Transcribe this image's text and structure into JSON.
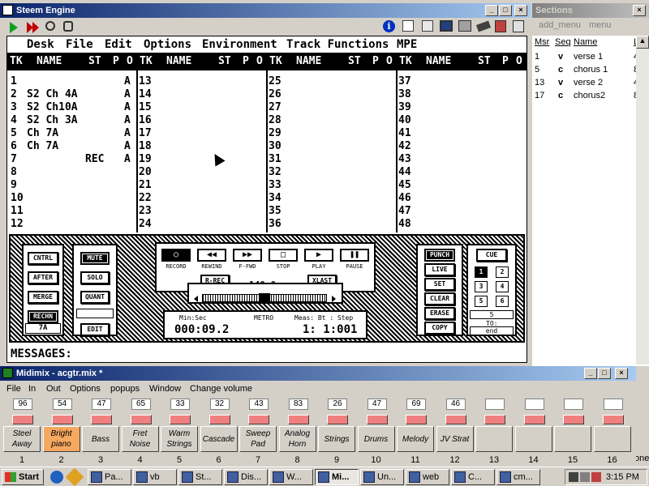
{
  "steem": {
    "title": "Steem Engine",
    "menus": [
      "Desk",
      "File",
      "Edit",
      "Options",
      "Environment",
      "Track Functions",
      "MPE"
    ],
    "headers": {
      "tk": "TK",
      "name": "NAME",
      "st": "ST",
      "p": "P",
      "o": "O"
    },
    "tracks": [
      {
        "n": "1",
        "name": "",
        "st": "",
        "a": "A"
      },
      {
        "n": "2",
        "name": "S2 Ch 4A",
        "st": "",
        "a": "A"
      },
      {
        "n": "3",
        "name": "S2 Ch10A",
        "st": "",
        "a": "A"
      },
      {
        "n": "4",
        "name": "S2 Ch 3A",
        "st": "",
        "a": "A"
      },
      {
        "n": "5",
        "name": "Ch 7A",
        "st": "",
        "a": "A"
      },
      {
        "n": "6",
        "name": "Ch 7A",
        "st": "",
        "a": "A"
      },
      {
        "n": "7",
        "name": "",
        "st": "REC",
        "a": "A"
      },
      {
        "n": "8",
        "name": "",
        "st": "",
        "a": ""
      },
      {
        "n": "9",
        "name": "",
        "st": "",
        "a": ""
      },
      {
        "n": "10",
        "name": "",
        "st": "",
        "a": ""
      },
      {
        "n": "11",
        "name": "",
        "st": "",
        "a": ""
      },
      {
        "n": "12",
        "name": "",
        "st": "",
        "a": ""
      }
    ],
    "col2": [
      "13",
      "14",
      "15",
      "16",
      "17",
      "18",
      "19",
      "20",
      "21",
      "22",
      "23",
      "24"
    ],
    "col3": [
      "25",
      "26",
      "27",
      "28",
      "29",
      "30",
      "31",
      "32",
      "33",
      "34",
      "35",
      "36"
    ],
    "col4": [
      "37",
      "38",
      "39",
      "40",
      "41",
      "42",
      "43",
      "44",
      "45",
      "46",
      "47",
      "48"
    ],
    "left_buttons": [
      "CNTRL",
      "AFTER",
      "MERGE",
      "RECHN"
    ],
    "mid_buttons": [
      "MUTE",
      "SOLO",
      "QUANT",
      "EDIT"
    ],
    "channel_value": "7A",
    "transport": [
      "RECORD",
      "REWIND",
      "F-FWD",
      "STOP",
      "PLAY",
      "PAUSE"
    ],
    "rrec": "R-REC",
    "xlast": "XLAST",
    "tempo": "140.0",
    "bpm": "BPM",
    "minsec_label": "Min:Sec",
    "time": "000:09.2",
    "metro_label": "METRO",
    "meas_label": "Meas: Bt : Step",
    "meas": "1: 1:001",
    "right_buttons": [
      "PUNCH",
      "LIVE",
      "SET",
      "CLEAR",
      "ERASE",
      "COPY"
    ],
    "cue": "CUE",
    "cue_nums": [
      "1",
      "2",
      "3",
      "4",
      "5",
      "6"
    ],
    "cue_value": "5",
    "to_label": "TO:",
    "to_value": "end",
    "messages": "MESSAGES:"
  },
  "sections": {
    "title": "Sections",
    "menu": [
      "add_menu",
      "menu"
    ],
    "headers": [
      "Msr",
      "Seq",
      "Name",
      "L"
    ],
    "rows": [
      {
        "msr": "1",
        "seq": "v",
        "name": "verse 1",
        "l": "4"
      },
      {
        "msr": "5",
        "seq": "c",
        "name": "chorus 1",
        "l": "8"
      },
      {
        "msr": "13",
        "seq": "v",
        "name": "verse 2",
        "l": "4"
      },
      {
        "msr": "17",
        "seq": "c",
        "name": "chorus2",
        "l": "8"
      }
    ],
    "side_text": "one"
  },
  "midimix": {
    "title": "Midimix - acgtr.mix *",
    "menus": [
      "File",
      "In",
      "Out",
      "Options",
      "popups",
      "Window",
      "Change volume"
    ],
    "values": [
      "96",
      "54",
      "47",
      "65",
      "33",
      "32",
      "43",
      "83",
      "26",
      "47",
      "69",
      "46",
      "",
      "",
      "",
      ""
    ],
    "names": [
      "Steel Away",
      "Bright piano",
      "Bass",
      "Fret Noise",
      "Warm Strings",
      "Cascade",
      "Sweep Pad",
      "Analog Horn",
      "Strings",
      "Drums",
      "Melody",
      "JV Strat",
      "",
      "",
      "",
      ""
    ],
    "channels": [
      "1",
      "2",
      "3",
      "4",
      "5",
      "6",
      "7",
      "8",
      "9",
      "10",
      "11",
      "12",
      "13",
      "14",
      "15",
      "16"
    ]
  },
  "taskbar": {
    "start": "Start",
    "items": [
      "Pa...",
      "vb",
      "St...",
      "Dis...",
      "W...",
      "Mi...",
      "Un...",
      "web",
      "C...",
      "cm..."
    ],
    "clock": "3:15 PM"
  }
}
